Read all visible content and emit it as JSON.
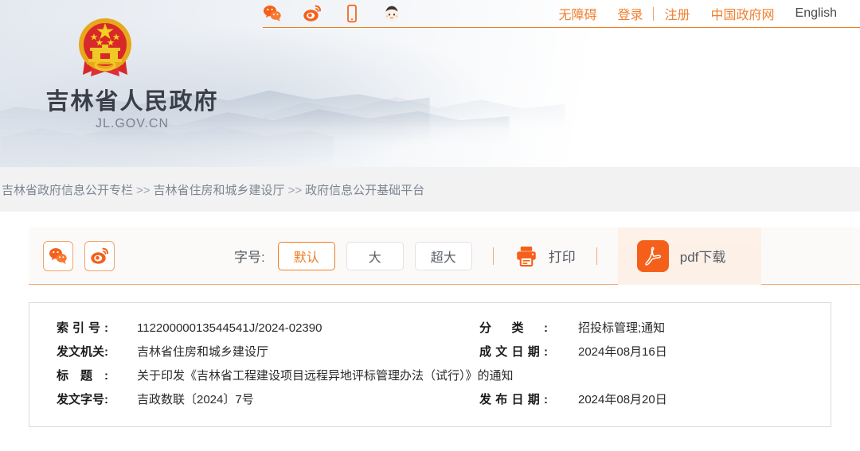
{
  "header": {
    "site_title": "吉林省人民政府",
    "site_domain": "JL.GOV.CN",
    "emblem_alt": "national-emblem",
    "social_icons": [
      {
        "name": "wechat-icon",
        "label": "微信"
      },
      {
        "name": "weibo-icon",
        "label": "微博"
      },
      {
        "name": "mobile-icon",
        "label": "手机版"
      },
      {
        "name": "mascot-icon",
        "label": "吉小政"
      }
    ],
    "links": [
      {
        "name": "accessibility-link",
        "label": "无障碍",
        "style": "orange"
      },
      {
        "name": "login-link",
        "label": "登录",
        "style": "orange"
      },
      {
        "name": "register-link",
        "label": "注册",
        "style": "orange"
      },
      {
        "name": "china-gov-link",
        "label": "中国政府网",
        "style": "orange"
      },
      {
        "name": "english-link",
        "label": "English",
        "style": "dark"
      }
    ]
  },
  "breadcrumb": {
    "items": [
      "吉林省政府信息公开专栏",
      "吉林省住房和城乡建设厅",
      "政府信息公开基础平台"
    ],
    "separator": ">>"
  },
  "toolbar": {
    "share": [
      {
        "name": "share-wechat-button",
        "label": "微信分享"
      },
      {
        "name": "share-weibo-button",
        "label": "微博分享"
      }
    ],
    "fontsize_label": "字号:",
    "fontsize_options": [
      {
        "label": "默认",
        "active": true
      },
      {
        "label": "大",
        "active": false
      },
      {
        "label": "超大",
        "active": false
      }
    ],
    "print_label": "打印",
    "pdf_label": "pdf下载"
  },
  "meta": {
    "rows_left": [
      {
        "key": "索引号:",
        "value": "11220000013544541J/2024-02390"
      },
      {
        "key": "发文机关:",
        "value": "吉林省住房和城乡建设厅"
      },
      {
        "key": "标题:",
        "value": "关于印发《吉林省工程建设项目远程异地评标管理办法（试行）》的通知"
      },
      {
        "key": "发文字号:",
        "value": "吉政数联〔2024〕7号"
      }
    ],
    "rows_right": [
      {
        "key": "分类:",
        "value": "招投标管理;通知"
      },
      {
        "key": "成文日期:",
        "value": "2024年08月16日"
      },
      {
        "key": "",
        "value": ""
      },
      {
        "key": "发布日期:",
        "value": "2024年08月20日"
      }
    ]
  },
  "colors": {
    "accent_orange": "#f07a22",
    "pdf_orange": "#f4601a",
    "link_orange": "#f08030",
    "crumb_bg": "#f2f2f2",
    "toolbar_bg": "#fcfaf8",
    "pdf_bg": "#fdf1e8",
    "title_text": "#3a3f47",
    "crumb_text": "#7c8592"
  }
}
